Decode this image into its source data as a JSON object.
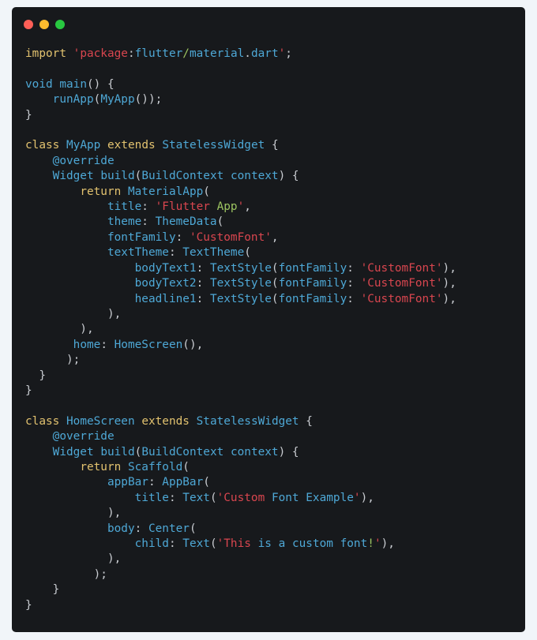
{
  "window": {
    "controls": [
      {
        "name": "close",
        "color": "#ff5f57"
      },
      {
        "name": "minimize",
        "color": "#febc2e"
      },
      {
        "name": "maximize",
        "color": "#28c840"
      }
    ]
  },
  "code": {
    "language": "dart",
    "lines": [
      [
        [
          "kw",
          "import"
        ],
        [
          "p",
          " "
        ],
        [
          "str",
          "'package"
        ],
        [
          "p",
          ":"
        ],
        [
          "id",
          "flutter"
        ],
        [
          "grn",
          "/"
        ],
        [
          "id",
          "material"
        ],
        [
          "p",
          "."
        ],
        [
          "id",
          "dart"
        ],
        [
          "str",
          "'"
        ],
        [
          "p",
          ";"
        ]
      ],
      [],
      [
        [
          "id",
          "void"
        ],
        [
          "p",
          " "
        ],
        [
          "id",
          "main"
        ],
        [
          "p",
          "() {"
        ]
      ],
      [
        [
          "p",
          "    "
        ],
        [
          "id",
          "runApp"
        ],
        [
          "p",
          "("
        ],
        [
          "id",
          "MyApp"
        ],
        [
          "p",
          "());"
        ]
      ],
      [
        [
          "p",
          "}"
        ]
      ],
      [],
      [
        [
          "kw",
          "class"
        ],
        [
          "p",
          " "
        ],
        [
          "id",
          "MyApp"
        ],
        [
          "p",
          " "
        ],
        [
          "kw",
          "extends"
        ],
        [
          "p",
          " "
        ],
        [
          "id",
          "StatelessWidget"
        ],
        [
          "p",
          " {"
        ]
      ],
      [
        [
          "p",
          "    "
        ],
        [
          "id",
          "@override"
        ]
      ],
      [
        [
          "p",
          "    "
        ],
        [
          "id",
          "Widget"
        ],
        [
          "p",
          " "
        ],
        [
          "id",
          "build"
        ],
        [
          "p",
          "("
        ],
        [
          "id",
          "BuildContext"
        ],
        [
          "p",
          " "
        ],
        [
          "id",
          "context"
        ],
        [
          "p",
          ") {"
        ]
      ],
      [
        [
          "p",
          "        "
        ],
        [
          "kw",
          "return"
        ],
        [
          "p",
          " "
        ],
        [
          "id",
          "MaterialApp"
        ],
        [
          "p",
          "("
        ]
      ],
      [
        [
          "p",
          "            "
        ],
        [
          "id",
          "title"
        ],
        [
          "p",
          ": "
        ],
        [
          "str",
          "'Flutter"
        ],
        [
          "p",
          " "
        ],
        [
          "grn",
          "App"
        ],
        [
          "str",
          "'"
        ],
        [
          "p",
          ","
        ]
      ],
      [
        [
          "p",
          "            "
        ],
        [
          "id",
          "theme"
        ],
        [
          "p",
          ": "
        ],
        [
          "id",
          "ThemeData"
        ],
        [
          "p",
          "("
        ]
      ],
      [
        [
          "p",
          "            "
        ],
        [
          "id",
          "fontFamily"
        ],
        [
          "p",
          ": "
        ],
        [
          "str",
          "'CustomFont'"
        ],
        [
          "p",
          ","
        ]
      ],
      [
        [
          "p",
          "            "
        ],
        [
          "id",
          "textTheme"
        ],
        [
          "p",
          ": "
        ],
        [
          "id",
          "TextTheme"
        ],
        [
          "p",
          "("
        ]
      ],
      [
        [
          "p",
          "                "
        ],
        [
          "id",
          "bodyText1"
        ],
        [
          "p",
          ": "
        ],
        [
          "id",
          "TextStyle"
        ],
        [
          "p",
          "("
        ],
        [
          "id",
          "fontFamily"
        ],
        [
          "p",
          ": "
        ],
        [
          "str",
          "'CustomFont'"
        ],
        [
          "p",
          "),"
        ]
      ],
      [
        [
          "p",
          "                "
        ],
        [
          "id",
          "bodyText2"
        ],
        [
          "p",
          ": "
        ],
        [
          "id",
          "TextStyle"
        ],
        [
          "p",
          "("
        ],
        [
          "id",
          "fontFamily"
        ],
        [
          "p",
          ": "
        ],
        [
          "str",
          "'CustomFont'"
        ],
        [
          "p",
          "),"
        ]
      ],
      [
        [
          "p",
          "                "
        ],
        [
          "id",
          "headline1"
        ],
        [
          "p",
          ": "
        ],
        [
          "id",
          "TextStyle"
        ],
        [
          "p",
          "("
        ],
        [
          "id",
          "fontFamily"
        ],
        [
          "p",
          ": "
        ],
        [
          "str",
          "'CustomFont'"
        ],
        [
          "p",
          "),"
        ]
      ],
      [
        [
          "p",
          "            ),"
        ]
      ],
      [
        [
          "p",
          "        ),"
        ]
      ],
      [
        [
          "p",
          "       "
        ],
        [
          "id",
          "home"
        ],
        [
          "p",
          ": "
        ],
        [
          "id",
          "HomeScreen"
        ],
        [
          "p",
          "(),"
        ]
      ],
      [
        [
          "p",
          "      );"
        ]
      ],
      [
        [
          "p",
          "  }"
        ]
      ],
      [
        [
          "p",
          "}"
        ]
      ],
      [],
      [
        [
          "kw",
          "class"
        ],
        [
          "p",
          " "
        ],
        [
          "id",
          "HomeScreen"
        ],
        [
          "p",
          " "
        ],
        [
          "kw",
          "extends"
        ],
        [
          "p",
          " "
        ],
        [
          "id",
          "StatelessWidget"
        ],
        [
          "p",
          " {"
        ]
      ],
      [
        [
          "p",
          "    "
        ],
        [
          "id",
          "@override"
        ]
      ],
      [
        [
          "p",
          "    "
        ],
        [
          "id",
          "Widget"
        ],
        [
          "p",
          " "
        ],
        [
          "id",
          "build"
        ],
        [
          "p",
          "("
        ],
        [
          "id",
          "BuildContext"
        ],
        [
          "p",
          " "
        ],
        [
          "id",
          "context"
        ],
        [
          "p",
          ") {"
        ]
      ],
      [
        [
          "p",
          "        "
        ],
        [
          "kw",
          "return"
        ],
        [
          "p",
          " "
        ],
        [
          "id",
          "Scaffold"
        ],
        [
          "p",
          "("
        ]
      ],
      [
        [
          "p",
          "            "
        ],
        [
          "id",
          "appBar"
        ],
        [
          "p",
          ": "
        ],
        [
          "id",
          "AppBar"
        ],
        [
          "p",
          "("
        ]
      ],
      [
        [
          "p",
          "                "
        ],
        [
          "id",
          "title"
        ],
        [
          "p",
          ": "
        ],
        [
          "id",
          "Text"
        ],
        [
          "p",
          "("
        ],
        [
          "str",
          "'Custom"
        ],
        [
          "p",
          " "
        ],
        [
          "id",
          "Font"
        ],
        [
          "p",
          " "
        ],
        [
          "id",
          "Example"
        ],
        [
          "str",
          "'"
        ],
        [
          "p",
          "),"
        ]
      ],
      [
        [
          "p",
          "            ),"
        ]
      ],
      [
        [
          "p",
          "            "
        ],
        [
          "id",
          "body"
        ],
        [
          "p",
          ": "
        ],
        [
          "id",
          "Center"
        ],
        [
          "p",
          "("
        ]
      ],
      [
        [
          "p",
          "                "
        ],
        [
          "id",
          "child"
        ],
        [
          "p",
          ": "
        ],
        [
          "id",
          "Text"
        ],
        [
          "p",
          "("
        ],
        [
          "str",
          "'This"
        ],
        [
          "p",
          " "
        ],
        [
          "id",
          "is"
        ],
        [
          "p",
          " "
        ],
        [
          "id",
          "a"
        ],
        [
          "p",
          " "
        ],
        [
          "id",
          "custom"
        ],
        [
          "p",
          " "
        ],
        [
          "id",
          "font"
        ],
        [
          "grn",
          "!"
        ],
        [
          "str",
          "'"
        ],
        [
          "p",
          "),"
        ]
      ],
      [
        [
          "p",
          "            ),"
        ]
      ],
      [
        [
          "p",
          "          );"
        ]
      ],
      [
        [
          "p",
          "    }"
        ]
      ],
      [
        [
          "p",
          "}"
        ]
      ]
    ]
  }
}
